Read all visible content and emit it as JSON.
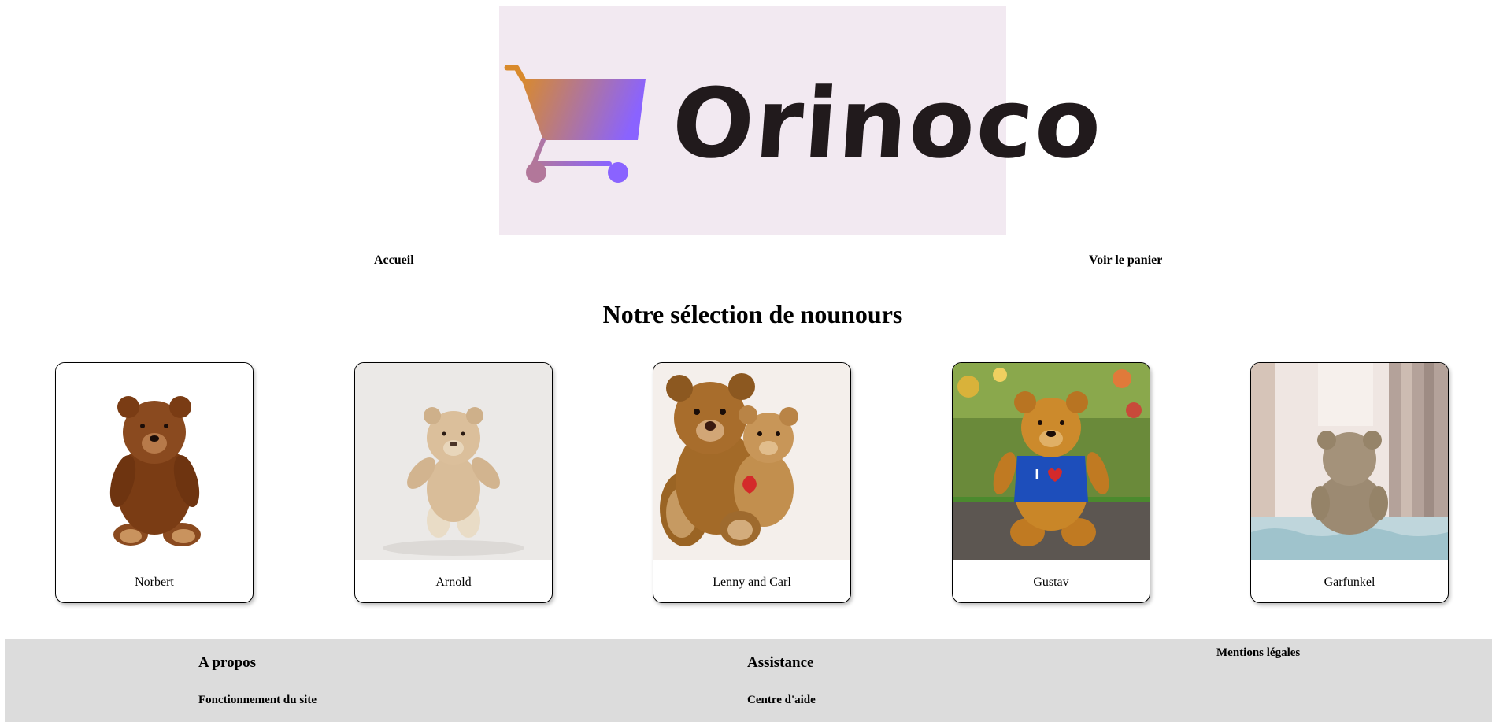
{
  "header": {
    "brand_name": "Orinoco",
    "logo_bg": "#f2e9f1",
    "cart_gradient": [
      "#d98a2c",
      "#8a63ff"
    ]
  },
  "nav": {
    "home_label": "Accueil",
    "cart_label": "Voir le panier"
  },
  "main": {
    "title": "Notre sélection de nounours",
    "products": [
      {
        "name": "Norbert",
        "icon": "teddy-bear-photo"
      },
      {
        "name": "Arnold",
        "icon": "teddy-bear-photo"
      },
      {
        "name": "Lenny and Carl",
        "icon": "teddy-bear-photo"
      },
      {
        "name": "Gustav",
        "icon": "teddy-bear-photo"
      },
      {
        "name": "Garfunkel",
        "icon": "teddy-bear-photo"
      }
    ]
  },
  "footer": {
    "bg": "#dcdcdc",
    "about": {
      "heading": "A propos",
      "link": "Fonctionnement du site"
    },
    "support": {
      "heading": "Assistance",
      "link": "Centre d'aide"
    },
    "legal_link": "Mentions légales"
  }
}
